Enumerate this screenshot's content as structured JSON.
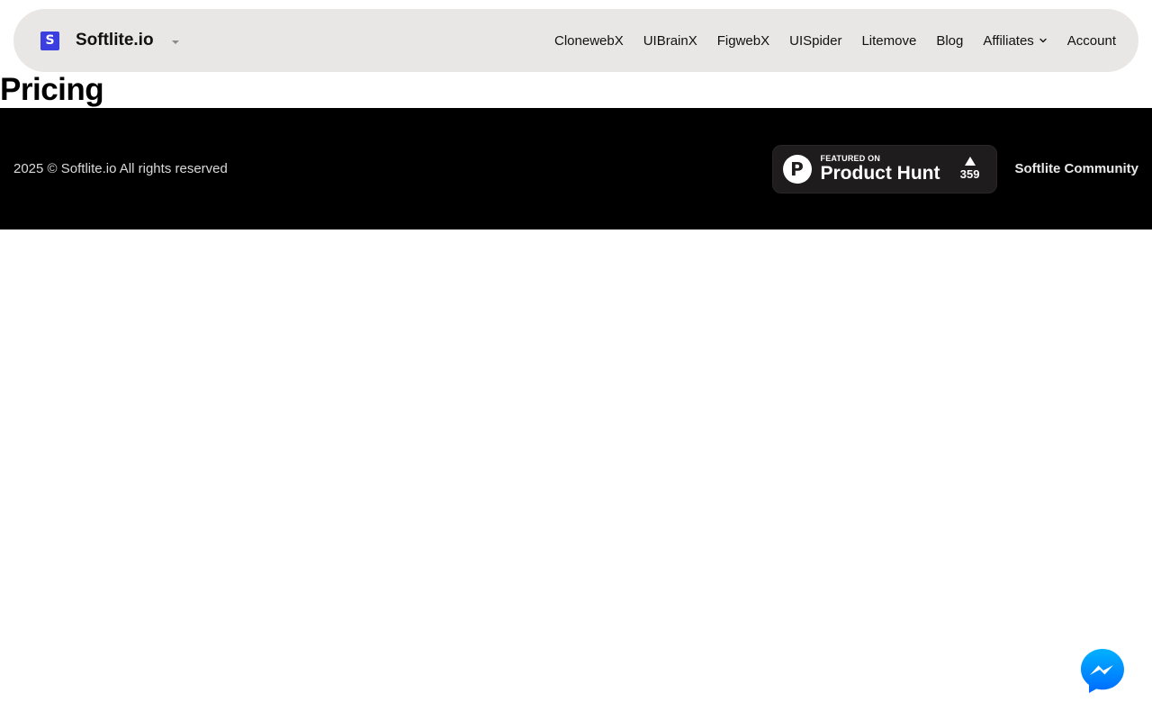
{
  "header": {
    "logo_letter": "S",
    "brand": "Softlite.io",
    "nav": [
      {
        "label": "ClonewebX"
      },
      {
        "label": "UIBrainX"
      },
      {
        "label": "FigwebX"
      },
      {
        "label": "UISpider"
      },
      {
        "label": "Litemove"
      },
      {
        "label": "Blog"
      },
      {
        "label": "Affiliates",
        "has_dropdown": true
      },
      {
        "label": "Account"
      }
    ]
  },
  "main": {
    "title": "Pricing"
  },
  "footer": {
    "copyright": "2025 © Softlite.io All rights reserved",
    "product_hunt": {
      "featured": "FEATURED ON",
      "name": "Product Hunt",
      "logo_letter": "P",
      "votes": "359"
    },
    "community_link": "Softlite Community"
  },
  "colors": {
    "header_bg": "#e8e7e5",
    "logo_accent": "#3b3fe0",
    "footer_bg": "#000000",
    "badge_bg": "#1f1c1e",
    "messenger_gradient_start": "#00b2ff",
    "messenger_gradient_end": "#006aff"
  },
  "icons": {
    "brand_caret": "caret-down-icon",
    "affiliates_chevron": "chevron-down-icon",
    "ph_logo": "product-hunt-logo",
    "ph_upvote": "triangle-up-icon",
    "chat": "messenger-icon"
  }
}
